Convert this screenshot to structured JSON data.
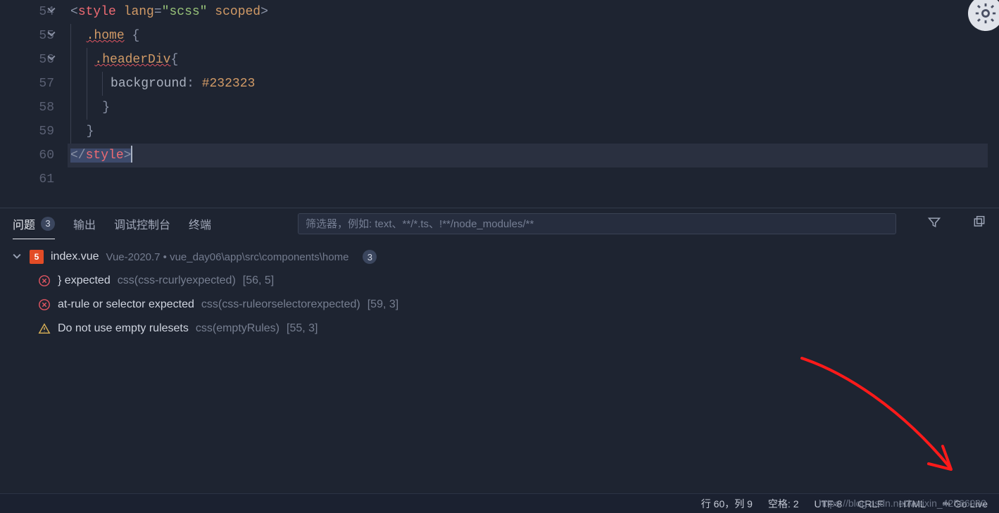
{
  "editor": {
    "first_line": 54,
    "current_line": 60,
    "lines": [
      {
        "n": 54,
        "fold": true,
        "html": "<span class='punc'>&lt;</span><span class='tag'>style</span> <span class='attr'>lang</span><span class='punc'>=</span><span class='str'>\"scss\"</span> <span class='attr'>scoped</span><span class='punc'>&gt;</span>"
      },
      {
        "n": 55,
        "fold": true,
        "html": "<span class='indent-guide'></span>  <span class='sel sq'>.home</span> <span class='punc'>{</span>"
      },
      {
        "n": 56,
        "fold": true,
        "html": "<span class='indent-guide'></span>  <span class='indent-guide'></span> <span class='sel sq'>.headerDiv</span><span class='punc'>{</span>"
      },
      {
        "n": 57,
        "fold": false,
        "html": "<span class='indent-guide'></span>  <span class='indent-guide'></span>  <span class='indent-guide'></span> <span class='prop'>background</span><span class='punc'>:</span> <span class='num'>#232323</span>"
      },
      {
        "n": 58,
        "fold": false,
        "html": "<span class='indent-guide'></span>  <span class='indent-guide'></span>  <span class='punc'>}</span>"
      },
      {
        "n": 59,
        "fold": false,
        "html": "<span class='indent-guide'></span>  <span class='punc'>}</span>"
      },
      {
        "n": 60,
        "fold": false,
        "current": true,
        "html": "<span class='sel-bg'><span class='punc'>&lt;/</span><span class='tag'>style</span><span class='punc'>&gt;</span></span><span class='cursor'></span>"
      },
      {
        "n": 61,
        "fold": false,
        "html": ""
      }
    ]
  },
  "panel": {
    "tabs": {
      "problems": "问题",
      "problems_count": "3",
      "output": "输出",
      "debug": "调试控制台",
      "terminal": "终端"
    },
    "filter_placeholder": "筛选器，例如: text、**/*.ts、!**/node_modules/**",
    "file": {
      "name": "index.vue",
      "meta": "Vue-2020.7 • vue_day06\\app\\src\\components\\home",
      "count": "3"
    },
    "issues": [
      {
        "sev": "err",
        "msg": "} expected",
        "code": "css(css-rcurlyexpected)",
        "loc": "[56, 5]"
      },
      {
        "sev": "err",
        "msg": "at-rule or selector expected",
        "code": "css(css-ruleorselectorexpected)",
        "loc": "[59, 3]"
      },
      {
        "sev": "warn",
        "msg": "Do not use empty rulesets",
        "code": "css(emptyRules)",
        "loc": "[55, 3]"
      }
    ]
  },
  "status": {
    "cursor": "行 60，列 9",
    "spaces": "空格: 2",
    "enc": "UTF-8",
    "eol": "CRLF",
    "lang": "HTML",
    "live": "Go Live"
  },
  "watermark": "https://blog.csdn.net/weixin_42566993"
}
